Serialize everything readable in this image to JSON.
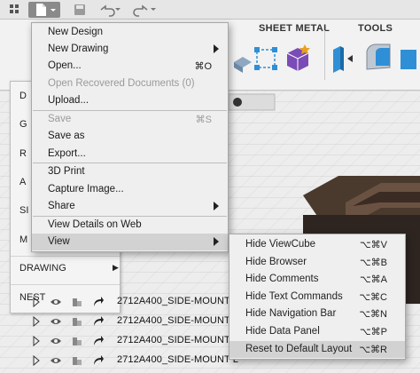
{
  "toolbar": {
    "icons": [
      "grid-icon",
      "file-icon",
      "save-icon",
      "undo-icon",
      "redo-icon"
    ]
  },
  "ribbon": {
    "sheet_metal_label": "SHEET METAL",
    "tools_label": "TOOLS",
    "colors": {
      "blue": "#2f8fd6",
      "purple": "#7b4bb6",
      "accent_orange": "#e8a020"
    }
  },
  "browser_panel": {
    "letters": [
      "D",
      "G",
      "R",
      "A",
      "SI",
      "M"
    ],
    "drawing_label": "DRAWING",
    "nest_label": "NEST"
  },
  "tree": {
    "rows": [
      "2712A400_SIDE-MOUNT",
      "2712A400_SIDE-MOUNT",
      "2712A400_SIDE-MOUNT",
      "2712A400_SIDE-MOUNT L"
    ]
  },
  "file_menu": {
    "items": [
      {
        "label": "New Design",
        "shortcut": "",
        "submenu": false,
        "disabled": false
      },
      {
        "label": "New Drawing",
        "shortcut": "",
        "submenu": true,
        "disabled": false
      },
      {
        "label": "Open...",
        "shortcut": "⌘O",
        "submenu": false,
        "disabled": false
      },
      {
        "label": "Open Recovered Documents (0)",
        "shortcut": "",
        "submenu": false,
        "disabled": true
      },
      {
        "label": "Upload...",
        "shortcut": "",
        "submenu": false,
        "disabled": false
      },
      {
        "label": "Save",
        "shortcut": "⌘S",
        "submenu": false,
        "disabled": true
      },
      {
        "label": "Save as",
        "shortcut": "",
        "submenu": false,
        "disabled": false
      },
      {
        "label": "Export...",
        "shortcut": "",
        "submenu": false,
        "disabled": false
      },
      {
        "label": "3D Print",
        "shortcut": "",
        "submenu": false,
        "disabled": false
      },
      {
        "label": "Capture Image...",
        "shortcut": "",
        "submenu": false,
        "disabled": false
      },
      {
        "label": "Share",
        "shortcut": "",
        "submenu": true,
        "disabled": false
      },
      {
        "label": "View Details on Web",
        "shortcut": "",
        "submenu": false,
        "disabled": false
      },
      {
        "label": "View",
        "shortcut": "",
        "submenu": true,
        "disabled": false,
        "active": true
      }
    ]
  },
  "view_submenu": {
    "items": [
      {
        "label": "Hide ViewCube",
        "shortcut": "⌥⌘V"
      },
      {
        "label": "Hide Browser",
        "shortcut": "⌥⌘B"
      },
      {
        "label": "Hide Comments",
        "shortcut": "⌥⌘A"
      },
      {
        "label": "Hide Text Commands",
        "shortcut": "⌥⌘C"
      },
      {
        "label": "Hide Navigation Bar",
        "shortcut": "⌥⌘N"
      },
      {
        "label": "Hide Data Panel",
        "shortcut": "⌥⌘P"
      },
      {
        "label": "Reset to Default Layout",
        "shortcut": "⌥⌘R",
        "active": true
      }
    ]
  }
}
